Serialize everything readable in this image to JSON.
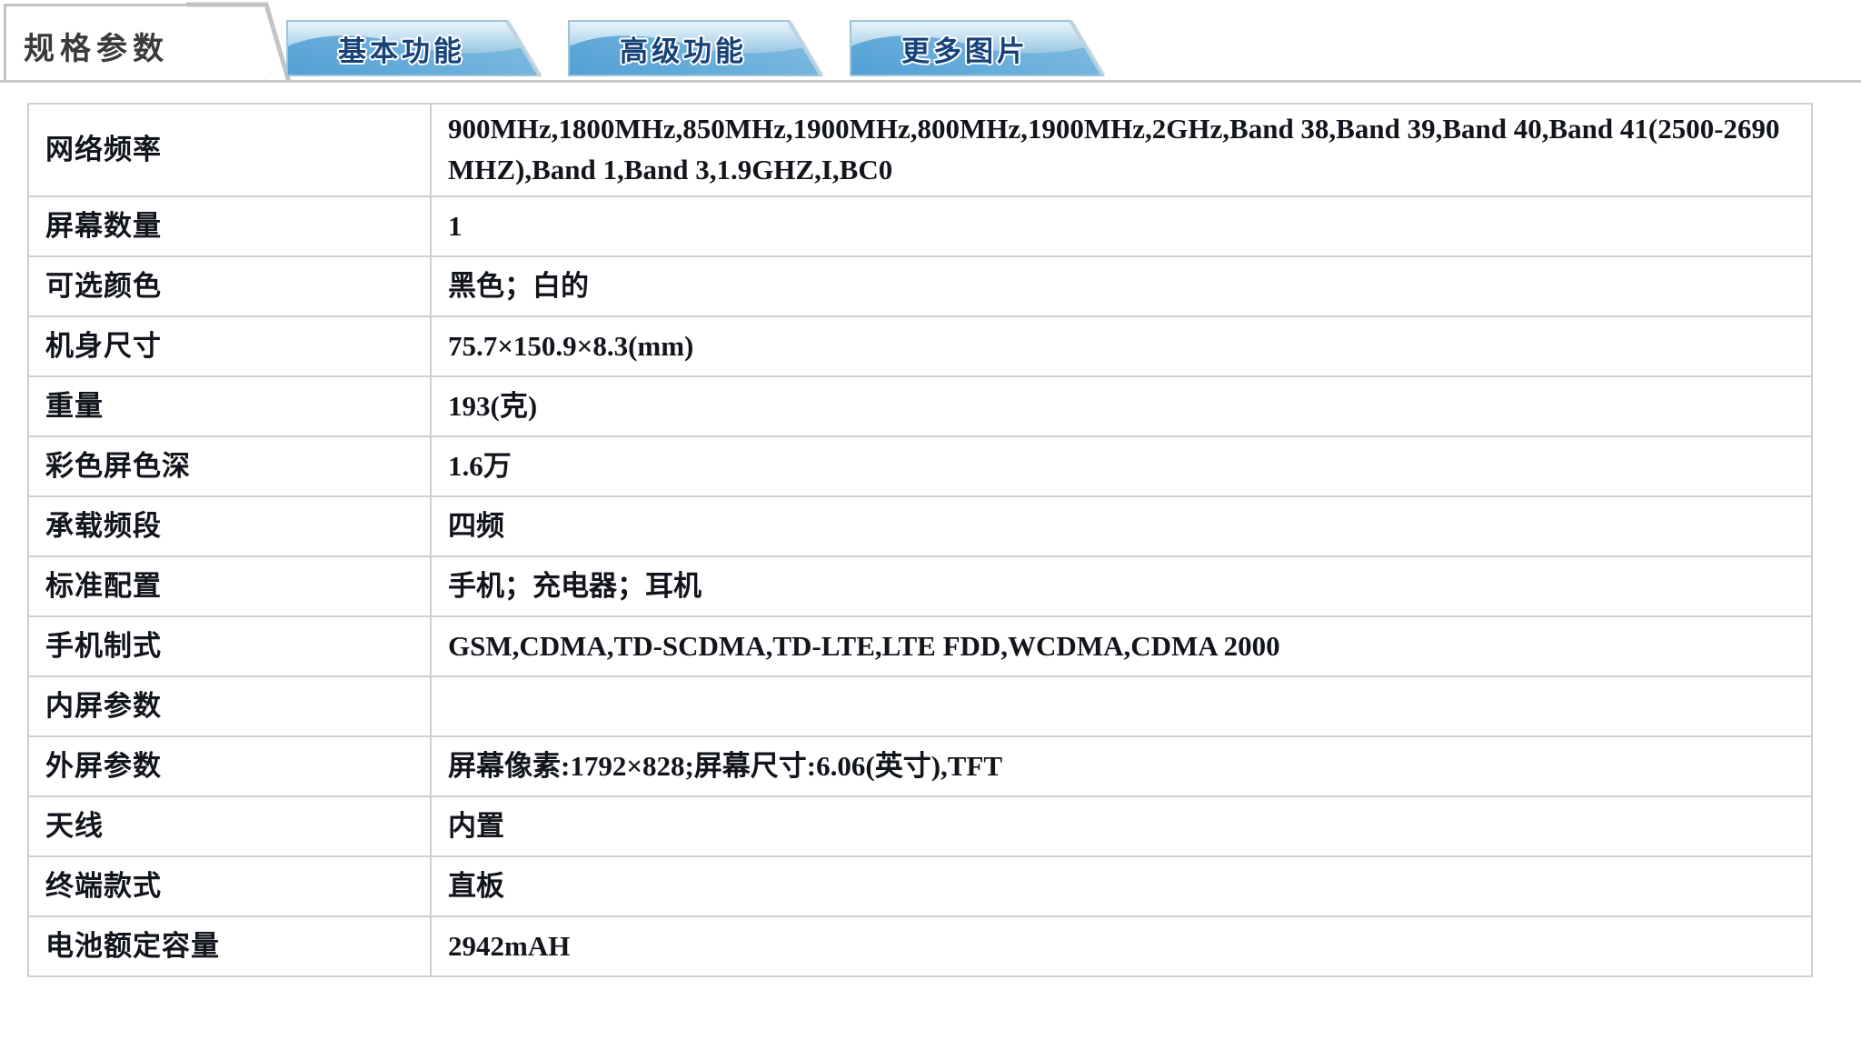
{
  "tabs": [
    {
      "label": "规格参数",
      "active": true
    },
    {
      "label": "基本功能",
      "active": false
    },
    {
      "label": "高级功能",
      "active": false
    },
    {
      "label": "更多图片",
      "active": false
    }
  ],
  "colors": {
    "tab_blue_top": "#d9eaf5",
    "tab_blue_mid": "#9fcbe6",
    "tab_blue_bottom": "#4e9ed4",
    "tab_text": "#16427a",
    "tab_border": "#c3c3c3",
    "table_border": "#cfcfcf",
    "text": "#12161c"
  },
  "spec_table": {
    "rows": [
      {
        "key": "网络频率",
        "value": "900MHz,1800MHz,850MHz,1900MHz,800MHz,1900MHz,2GHz,Band 38,Band 39,Band 40,Band 41(2500-2690 MHZ),Band 1,Band 3,1.9GHZ,I,BC0",
        "cjk": false,
        "tall": true
      },
      {
        "key": "屏幕数量",
        "value": "1",
        "cjk": false,
        "tall": false
      },
      {
        "key": "可选颜色",
        "value": "黑色；白的",
        "cjk": true,
        "tall": false
      },
      {
        "key": "机身尺寸",
        "value": "75.7×150.9×8.3(mm)",
        "cjk": false,
        "tall": false
      },
      {
        "key": "重量",
        "value": "193(克)",
        "cjk": false,
        "tall": false
      },
      {
        "key": "彩色屏色深",
        "value": "1.6万",
        "cjk": false,
        "tall": false
      },
      {
        "key": "承载频段",
        "value": "四频",
        "cjk": true,
        "tall": false
      },
      {
        "key": "标准配置",
        "value": "手机；充电器；耳机",
        "cjk": true,
        "tall": false
      },
      {
        "key": "手机制式",
        "value": "GSM,CDMA,TD-SCDMA,TD-LTE,LTE FDD,WCDMA,CDMA 2000",
        "cjk": false,
        "tall": false
      },
      {
        "key": "内屏参数",
        "value": "",
        "cjk": false,
        "tall": false
      },
      {
        "key": "外屏参数",
        "value": "屏幕像素:1792×828;屏幕尺寸:6.06(英寸),TFT",
        "cjk": false,
        "tall": false
      },
      {
        "key": "天线",
        "value": "内置",
        "cjk": true,
        "tall": false
      },
      {
        "key": "终端款式",
        "value": "直板",
        "cjk": true,
        "tall": false
      },
      {
        "key": "电池额定容量",
        "value": "2942mAH",
        "cjk": false,
        "tall": false
      }
    ]
  }
}
